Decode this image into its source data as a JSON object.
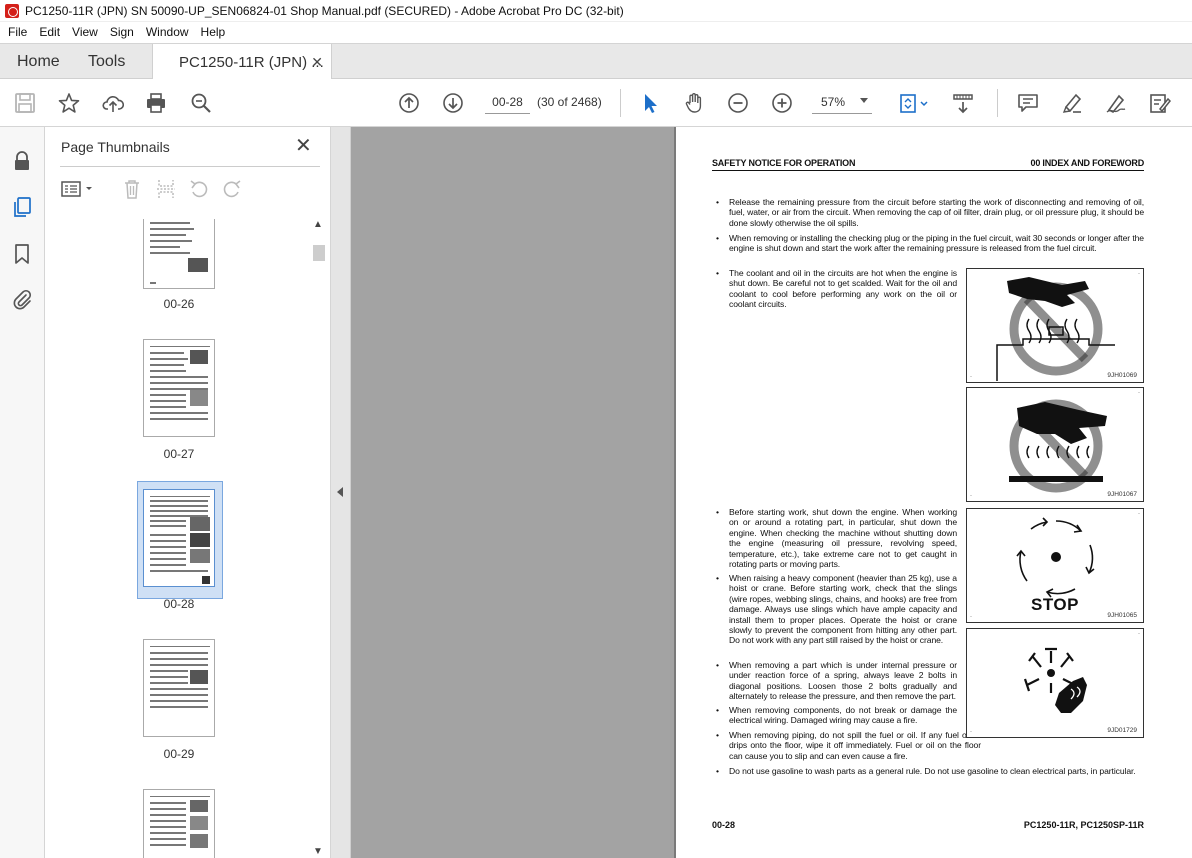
{
  "window": {
    "title": "PC1250-11R (JPN) SN 50090-UP_SEN06824-01 Shop Manual.pdf (SECURED) - Adobe Acrobat Pro DC (32-bit)"
  },
  "menu": [
    "File",
    "Edit",
    "View",
    "Sign",
    "Window",
    "Help"
  ],
  "tabs": {
    "home": "Home",
    "tools": "Tools",
    "doc": "PC1250-11R (JPN) ...",
    "close": "✕"
  },
  "toolbar": {
    "page_input": "00-28",
    "page_count": "(30 of 2468)",
    "zoom": "57%"
  },
  "thumbnail_panel": {
    "title": "Page Thumbnails",
    "close": "✕",
    "thumbnails": [
      {
        "label": "00-26",
        "selected": false
      },
      {
        "label": "00-27",
        "selected": false
      },
      {
        "label": "00-28",
        "selected": true
      },
      {
        "label": "00-29",
        "selected": false
      },
      {
        "label": "",
        "selected": false
      }
    ]
  },
  "page": {
    "header_left": "SAFETY NOTICE FOR OPERATION",
    "header_right": "00 INDEX AND FOREWORD",
    "bullet": "•",
    "bullets": [
      "Release the remaining pressure from the circuit before starting the work of disconnecting and removing of oil, fuel, water, or air from the circuit. When removing the cap of oil filter, drain plug, or oil pressure plug, it should be done slowly otherwise the oil spills.",
      "When removing or installing the checking plug or the piping in the fuel circuit, wait 30 seconds or longer after the engine is shut down and start the work after the remaining pressure is released from the fuel circuit.",
      "The coolant and oil in the circuits are hot when the engine is shut down. Be careful not to get scalded. Wait for the oil and coolant to cool before performing any work on the oil or coolant circuits.",
      "Before starting work, shut down the engine. When working on or around a rotating part, in particular, shut down the engine. When checking the machine without shutting down the engine (measuring oil pressure, revolving speed, temperature, etc.), take extreme care not to get caught in rotating parts or moving parts.",
      "When raising a heavy component (heavier than 25 kg), use a hoist or crane. Before starting work, check that the slings (wire ropes, webbing slings, chains, and hooks) are free from damage. Always use slings which have ample capacity and install them to proper places. Operate the hoist or crane slowly to prevent the component from hitting any other part. Do not work with any part still raised by the hoist or crane.",
      "When removing a part which is under internal pressure or under reaction force of a spring, always leave 2 bolts in diagonal positions. Loosen those 2 bolts gradually and alternately to release the pressure, and then remove the part.",
      "When removing components, do not break or damage the electrical wiring. Damaged wiring may cause a fire.",
      "When removing piping, do not spill the fuel or oil. If any fuel or oil drips onto the floor, wipe it off immediately. Fuel or oil on the floor can cause you to slip and can even cause a fire.",
      "Do not use gasoline to wash parts as a general rule. Do not use gasoline to clean electrical parts, in particular."
    ],
    "figures": [
      {
        "caption": "9JH01069"
      },
      {
        "caption": "9JH01067"
      },
      {
        "caption": "9JH01065",
        "text": "STOP"
      },
      {
        "caption": "9JD01729"
      }
    ],
    "footer_left": "00-28",
    "footer_right": "PC1250-11R, PC1250SP-11R"
  }
}
